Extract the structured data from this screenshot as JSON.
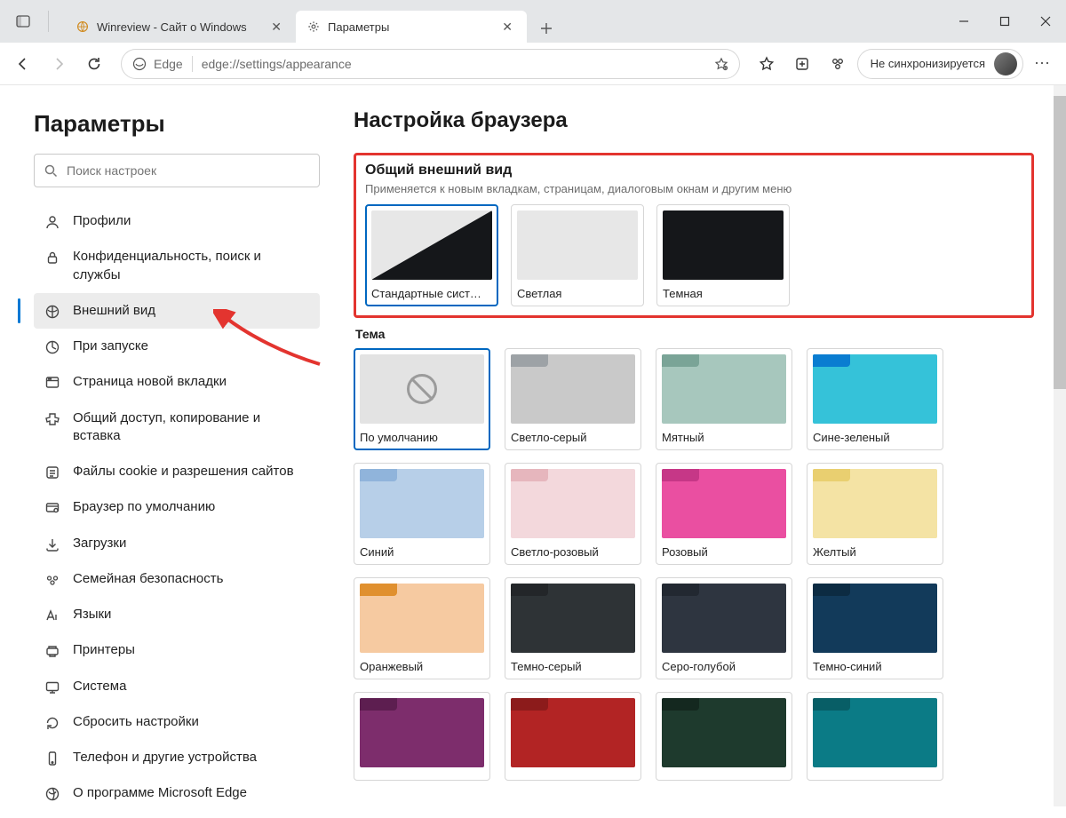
{
  "tabs": {
    "inactive_title": "Winreview - Сайт о Windows",
    "active_title": "Параметры"
  },
  "toolbar": {
    "identity_label": "Edge",
    "url": "edge://settings/appearance",
    "sync_label": "Не синхронизируется"
  },
  "sidebar": {
    "title": "Параметры",
    "search_placeholder": "Поиск настроек",
    "items": [
      {
        "label": "Профили"
      },
      {
        "label": "Конфиденциальность, поиск и службы"
      },
      {
        "label": "Внешний вид"
      },
      {
        "label": "При запуске"
      },
      {
        "label": "Страница новой вкладки"
      },
      {
        "label": "Общий доступ, копирование и вставка"
      },
      {
        "label": "Файлы cookie и разрешения сайтов"
      },
      {
        "label": "Браузер по умолчанию"
      },
      {
        "label": "Загрузки"
      },
      {
        "label": "Семейная безопасность"
      },
      {
        "label": "Языки"
      },
      {
        "label": "Принтеры"
      },
      {
        "label": "Система"
      },
      {
        "label": "Сбросить настройки"
      },
      {
        "label": "Телефон и другие устройства"
      },
      {
        "label": "О программе Microsoft Edge"
      }
    ]
  },
  "main": {
    "title": "Настройка браузера",
    "appearance": {
      "heading": "Общий внешний вид",
      "sub": "Применяется к новым вкладкам, страницам, диалоговым окнам и другим меню",
      "options": [
        {
          "label": "Стандартные сист…"
        },
        {
          "label": "Светлая"
        },
        {
          "label": "Темная"
        }
      ]
    },
    "theme": {
      "heading": "Тема",
      "items": [
        {
          "label": "По умолчанию",
          "bg": "#e3e3e3",
          "tab": "#e3e3e3",
          "default": true
        },
        {
          "label": "Светло-серый",
          "bg": "#c9c9c9",
          "tab": "#9da2a6"
        },
        {
          "label": "Мятный",
          "bg": "#a7c7bd",
          "tab": "#7aa497"
        },
        {
          "label": "Сине-зеленый",
          "bg": "#35c2d9",
          "tab": "#0a7dd1"
        },
        {
          "label": "Синий",
          "bg": "#b7cfe8",
          "tab": "#90b4db"
        },
        {
          "label": "Светло-розовый",
          "bg": "#f3d8dc",
          "tab": "#e6b6bd"
        },
        {
          "label": "Розовый",
          "bg": "#ea4fa1",
          "tab": "#c63787"
        },
        {
          "label": "Желтый",
          "bg": "#f4e3a4",
          "tab": "#e9cf70"
        },
        {
          "label": "Оранжевый",
          "bg": "#f6caa1",
          "tab": "#e0902f"
        },
        {
          "label": "Темно-серый",
          "bg": "#2e3336",
          "tab": "#232629"
        },
        {
          "label": "Серо-голубой",
          "bg": "#2e3540",
          "tab": "#222831"
        },
        {
          "label": "Темно-синий",
          "bg": "#123a5a",
          "tab": "#0c2b42"
        },
        {
          "label": "",
          "bg": "#7d2d6c",
          "tab": "#5d1e50"
        },
        {
          "label": "",
          "bg": "#b22424",
          "tab": "#8c1b1b"
        },
        {
          "label": "",
          "bg": "#1e3a2d",
          "tab": "#14281f"
        },
        {
          "label": "",
          "bg": "#0b7b86",
          "tab": "#085e66"
        }
      ]
    }
  }
}
